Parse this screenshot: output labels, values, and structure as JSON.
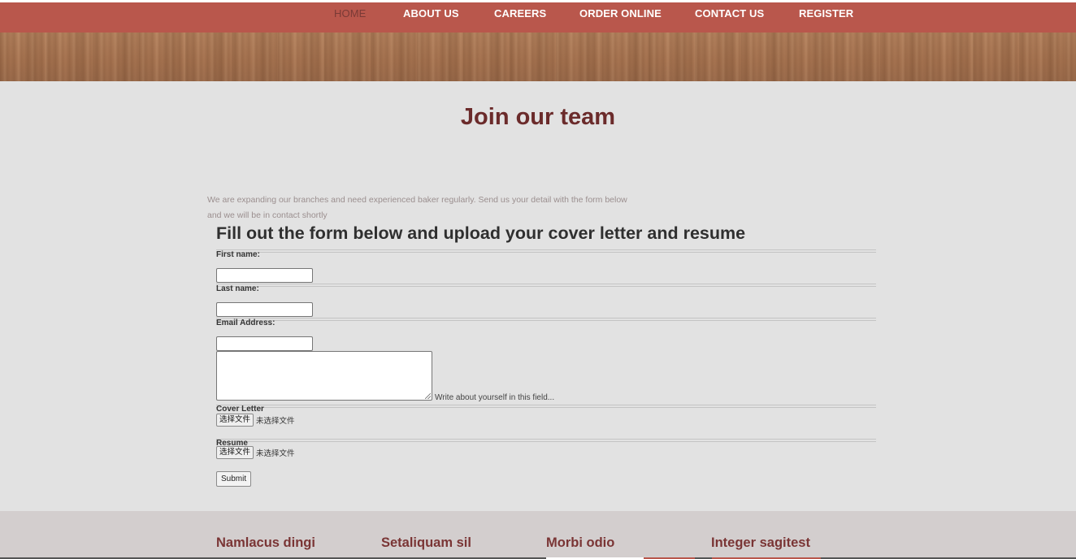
{
  "nav": {
    "items": [
      {
        "label": "HOME",
        "active": true
      },
      {
        "label": "ABOUT US",
        "active": false
      },
      {
        "label": "CAREERS",
        "active": false
      },
      {
        "label": "ORDER ONLINE",
        "active": false
      },
      {
        "label": "CONTACT US",
        "active": false
      },
      {
        "label": "REGISTER",
        "active": false
      }
    ]
  },
  "page": {
    "title": "Join our team",
    "intro_line1": "We are expanding our branches and need experienced baker regularly. Send us your detail with the form below",
    "intro_line2": "and we will be in contact shortly"
  },
  "form": {
    "heading": "Fill out the form below and upload your cover letter and resume",
    "first_name_label": "First name:",
    "first_name_value": "",
    "last_name_label": "Last name:",
    "last_name_value": "",
    "email_label": "Email Address:",
    "email_value": "",
    "about_value": "",
    "about_hint": "Write about yourself in this field...",
    "cover_letter_label": "Cover Letter",
    "resume_label": "Resume",
    "file_button_label": "选择文件",
    "no_file_text": "未选择文件",
    "submit_label": "Submit"
  },
  "footer": {
    "columns": [
      "Namlacus dingi",
      "Setaliquam sil",
      "Morbi odio",
      "Integer sagitest"
    ]
  },
  "colors": {
    "nav_bar": "#b9574c",
    "title": "#6b2b2b",
    "footer_title": "#7a3535"
  }
}
